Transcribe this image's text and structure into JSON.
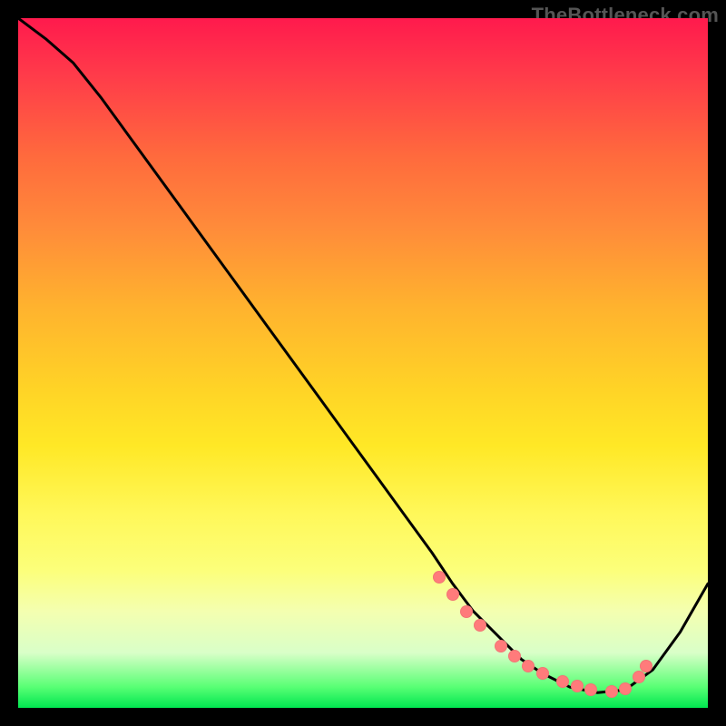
{
  "watermark": "TheBottleneck.com",
  "chart_data": {
    "type": "line",
    "title": "",
    "xlabel": "",
    "ylabel": "",
    "xlim": [
      0,
      100
    ],
    "ylim": [
      0,
      100
    ],
    "grid": false,
    "legend": false,
    "series": [
      {
        "name": "curve",
        "x": [
          0,
          4,
          8,
          12,
          16,
          20,
          24,
          28,
          32,
          36,
          40,
          44,
          48,
          52,
          56,
          60,
          63,
          66,
          70,
          73,
          76,
          80,
          84,
          88,
          92,
          96,
          100
        ],
        "values": [
          100,
          97,
          93.5,
          88.5,
          83,
          77.5,
          72,
          66.5,
          61,
          55.5,
          50,
          44.5,
          39,
          33.5,
          28,
          22.5,
          18,
          14,
          10,
          7,
          5,
          3,
          2.2,
          2.6,
          5.5,
          11,
          18
        ]
      }
    ],
    "markers": {
      "x": [
        61,
        63,
        65,
        67,
        70,
        72,
        74,
        76,
        79,
        81,
        83,
        86,
        88,
        90,
        91
      ],
      "y": [
        19,
        16.5,
        14,
        12,
        9,
        7.5,
        6,
        5,
        3.8,
        3.2,
        2.6,
        2.4,
        2.8,
        4.5,
        6
      ]
    },
    "colors": {
      "line": "#000000",
      "marker": "#ff7b7b"
    }
  }
}
